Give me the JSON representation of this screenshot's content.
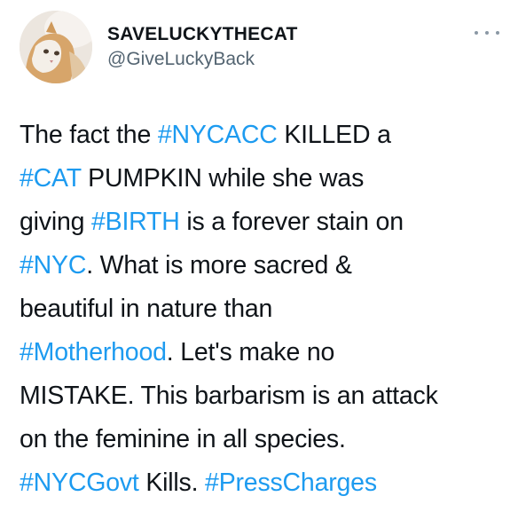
{
  "user": {
    "display_name": "SAVELUCKYTHECAT",
    "handle": "@GiveLuckyBack",
    "avatar_icon": "cat-photo-avatar"
  },
  "menu": {
    "icon": "more-horizontal-icon"
  },
  "colors": {
    "hashtag": "#1d9bf0",
    "text": "#0f1419",
    "secondary": "#536471"
  },
  "tweet": {
    "lines": [
      [
        {
          "text": "The fact the ",
          "link": false
        },
        {
          "text": "#NYCACC",
          "link": true
        },
        {
          "text": " KILLED a",
          "link": false
        }
      ],
      [
        {
          "text": "#CAT",
          "link": true
        },
        {
          "text": " PUMPKIN while she was",
          "link": false
        }
      ],
      [
        {
          "text": "giving ",
          "link": false
        },
        {
          "text": "#BIRTH",
          "link": true
        },
        {
          "text": " is a forever stain on",
          "link": false
        }
      ],
      [
        {
          "text": "#NYC",
          "link": true
        },
        {
          "text": ".  What is more sacred &",
          "link": false
        }
      ],
      [
        {
          "text": "beautiful in nature than",
          "link": false
        }
      ],
      [
        {
          "text": "#Motherhood",
          "link": true
        },
        {
          "text": ".  Let's make no",
          "link": false
        }
      ],
      [
        {
          "text": "MISTAKE. This barbarism is an attack",
          "link": false
        }
      ],
      [
        {
          "text": "on the feminine in all species.",
          "link": false
        }
      ],
      [
        {
          "text": "#NYCGovt",
          "link": true
        },
        {
          "text": " Kills.  ",
          "link": false
        },
        {
          "text": "#PressCharges",
          "link": true
        }
      ]
    ]
  }
}
